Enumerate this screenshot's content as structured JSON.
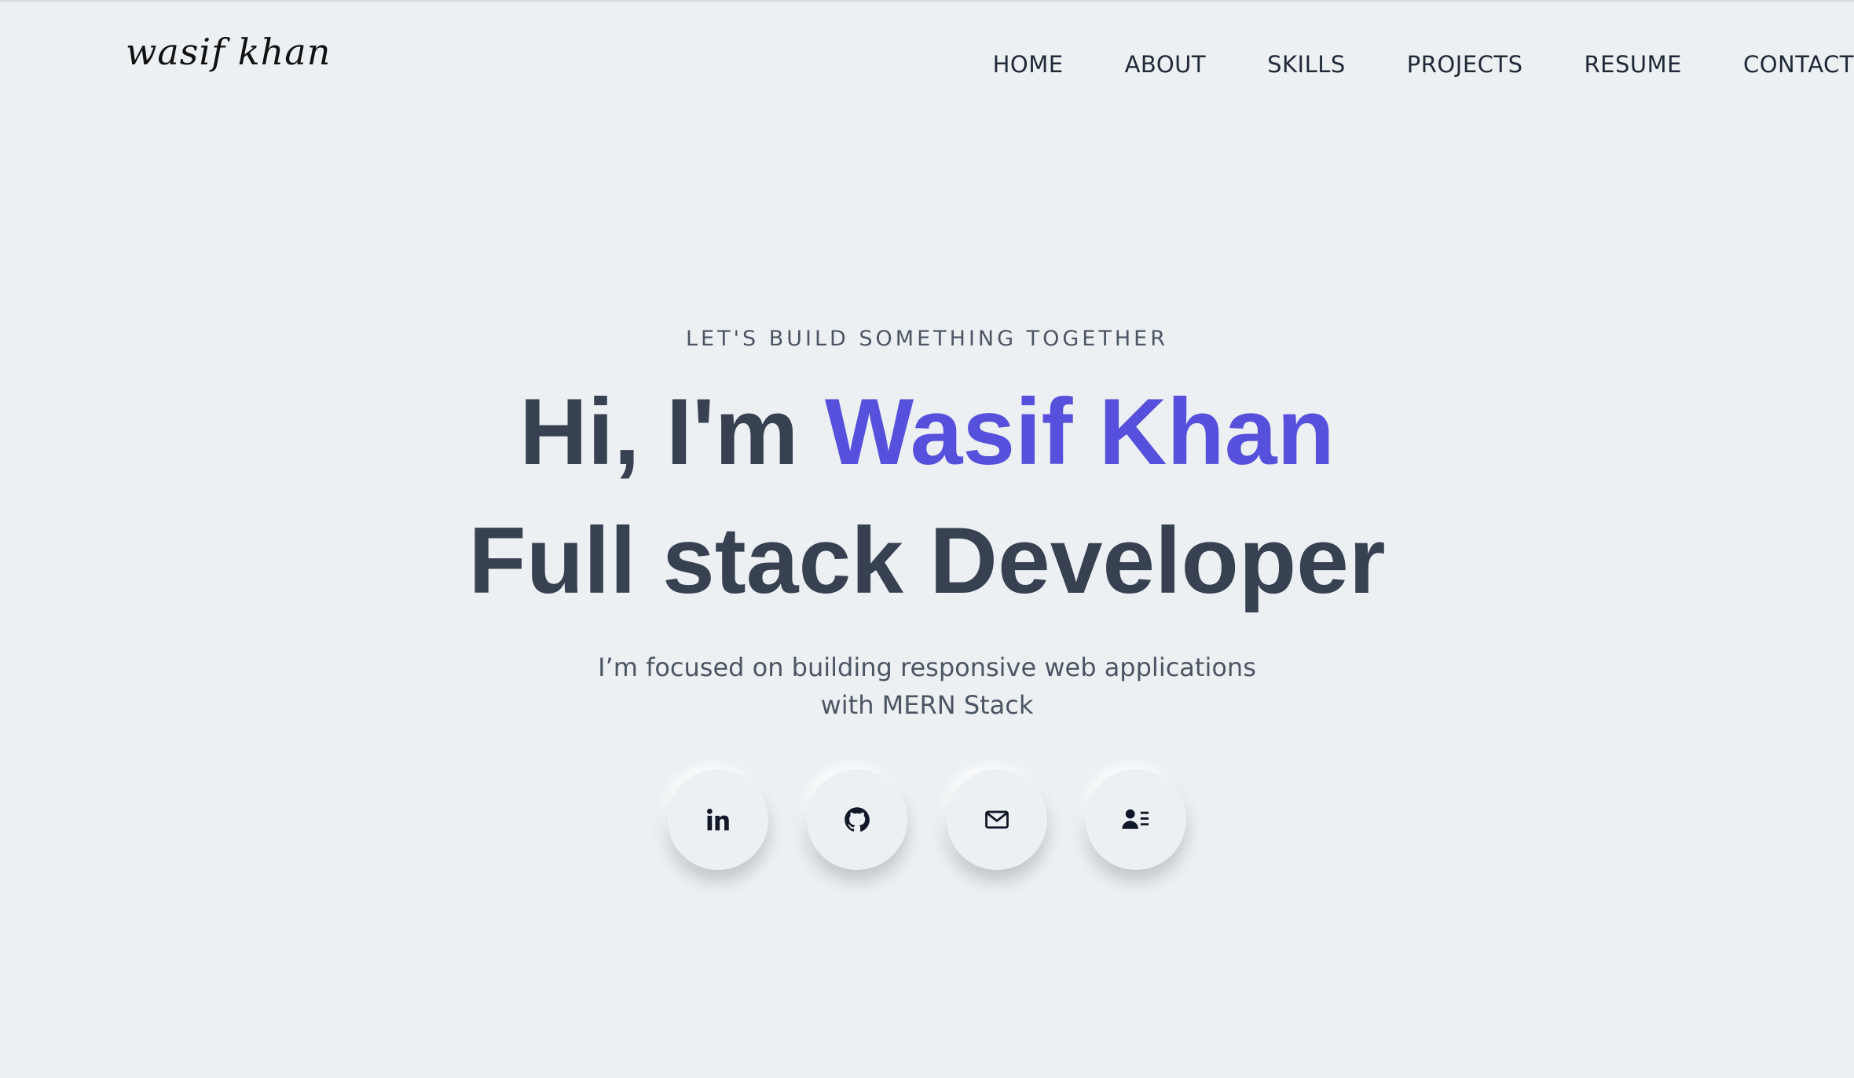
{
  "logo": {
    "text": "wasif khan"
  },
  "nav": {
    "items": [
      {
        "label": "HOME"
      },
      {
        "label": "ABOUT"
      },
      {
        "label": "SKILLS"
      },
      {
        "label": "PROJECTS"
      },
      {
        "label": "RESUME"
      },
      {
        "label": "CONTACT"
      }
    ]
  },
  "hero": {
    "eyebrow": "LET'S BUILD SOMETHING TOGETHER",
    "greeting": "Hi, I'm ",
    "name": "Wasif Khan",
    "role": "Full stack Developer",
    "tagline": "I’m focused on building responsive web applications with MERN Stack"
  },
  "socials": [
    {
      "icon": "linkedin-icon"
    },
    {
      "icon": "github-icon"
    },
    {
      "icon": "mail-icon"
    },
    {
      "icon": "contact-card-icon"
    }
  ],
  "colors": {
    "background": "#ecf0f3",
    "accent": "#5750dc",
    "heading": "#374151",
    "text": "#4b5563"
  }
}
